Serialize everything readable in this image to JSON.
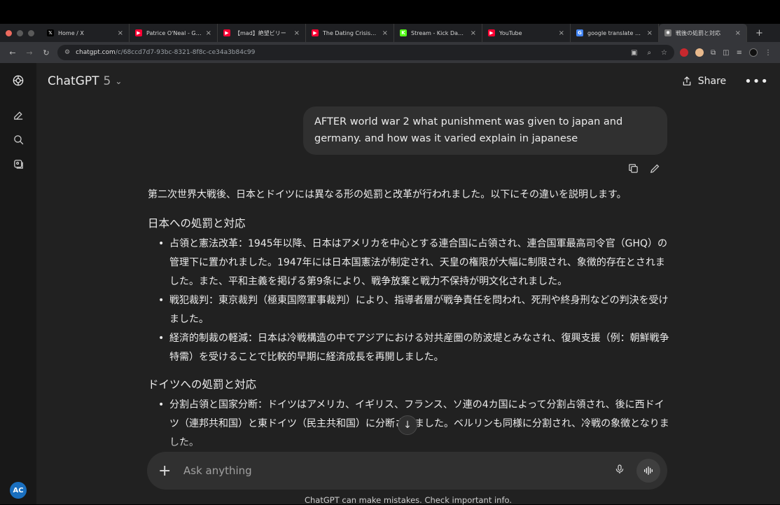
{
  "browser": {
    "tabs": [
      {
        "title": "Home / X",
        "icon": "x-logo-icon",
        "color": "#000000",
        "glyph": "𝕏"
      },
      {
        "title": "Patrice O'Neal - Getting",
        "icon": "youtube-icon",
        "color": "#ff0033",
        "glyph": "▶"
      },
      {
        "title": "【mad】絶望ビリー",
        "icon": "youtube-icon",
        "color": "#ff0033",
        "glyph": "▶"
      },
      {
        "title": "The Dating Crisis Has",
        "icon": "youtube-icon",
        "color": "#ff0033",
        "glyph": "▶"
      },
      {
        "title": "Stream - Kick Dashboard",
        "icon": "kick-logo-icon",
        "color": "#53fc18",
        "glyph": "K"
      },
      {
        "title": "YouTube",
        "icon": "youtube-icon",
        "color": "#ff0033",
        "glyph": "▶"
      },
      {
        "title": "google translate - Goog",
        "icon": "google-logo-icon",
        "color": "#4285f4",
        "glyph": "G"
      },
      {
        "title": "戦後の処罰と対応",
        "icon": "chatgpt-logo-icon",
        "color": "#777777",
        "glyph": "✺"
      }
    ],
    "url_host": "chatgpt.com",
    "url_path": "/c/68ccd7d7-93bc-8321-8f8c-ce34a3b84c99"
  },
  "header": {
    "model_name": "ChatGPT",
    "model_version": "5",
    "share_label": "Share"
  },
  "conversation": {
    "user_message": "AFTER world war 2 what punishment was given to japan and germany. and how was it varied explain in japanese",
    "answer": {
      "intro": "第二次世界大戦後、日本とドイツには異なる形の処罰と改革が行われました。以下にその違いを説明します。",
      "sections": [
        {
          "heading": "日本への処罰と対応",
          "items": [
            "占領と憲法改革：1945年以降、日本はアメリカを中心とする連合国に占領され、連合国軍最高司令官（GHQ）の管理下に置かれました。1947年には日本国憲法が制定され、天皇の権限が大幅に制限され、象徴的存在とされました。また、平和主義を掲げる第9条により、戦争放棄と戦力不保持が明文化されました。",
            "戦犯裁判：東京裁判（極東国際軍事裁判）により、指導者層が戦争責任を問われ、死刑や終身刑などの判決を受けました。",
            "経済的制裁の軽減：日本は冷戦構造の中でアジアにおける対共産圏の防波堤とみなされ、復興支援（例：朝鮮戦争特需）を受けることで比較的早期に経済成長を再開しました。"
          ]
        },
        {
          "heading": "ドイツへの処罰と対応",
          "items": [
            "分割占領と国家分断：ドイツはアメリカ、イギリス、フランス、ソ連の4カ国によって分割占領され、後に西ドイツ（連邦共和国）と東ドイツ（民主共和国）に分断されました。ベルリンも同様に分割され、冷戦の象徴となりました。"
          ]
        }
      ]
    }
  },
  "composer": {
    "placeholder": "Ask anything"
  },
  "footer": {
    "disclaimer": "ChatGPT can make mistakes. Check important info."
  },
  "user": {
    "initials": "AC"
  }
}
